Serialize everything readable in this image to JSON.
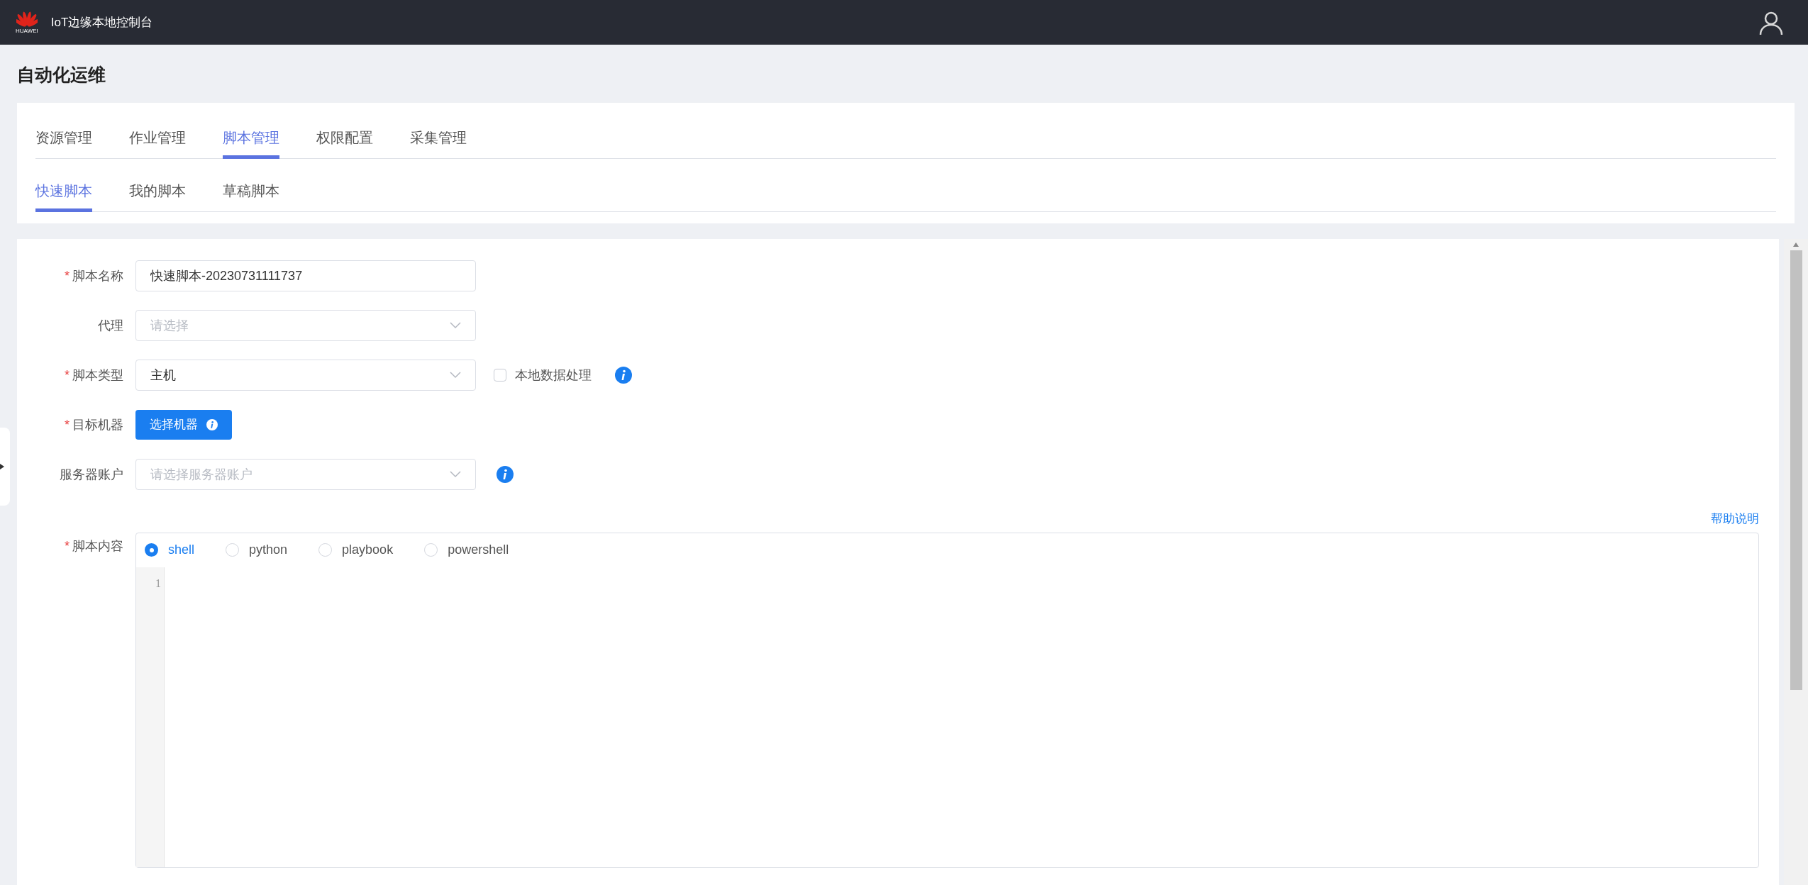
{
  "header": {
    "brand": "HUAWEI",
    "title": "IoT边缘本地控制台"
  },
  "page_title": "自动化运维",
  "tabs": [
    {
      "label": "资源管理",
      "selected": false
    },
    {
      "label": "作业管理",
      "selected": false
    },
    {
      "label": "脚本管理",
      "selected": true
    },
    {
      "label": "权限配置",
      "selected": false
    },
    {
      "label": "采集管理",
      "selected": false
    }
  ],
  "subtabs": [
    {
      "label": "快速脚本",
      "selected": true
    },
    {
      "label": "我的脚本",
      "selected": false
    },
    {
      "label": "草稿脚本",
      "selected": false
    }
  ],
  "form": {
    "fields": [
      {
        "kind": "input",
        "label": "脚本名称",
        "required_mark": "*",
        "value": "快速脚本-20230731111737"
      },
      {
        "kind": "select",
        "label": "代理",
        "placeholder": "请选择"
      },
      {
        "kind": "select",
        "label": "脚本类型",
        "required_mark": "*",
        "value": "主机",
        "checkbox": {
          "label": "本地数据处理",
          "checked": false
        },
        "addons": [
          {
            "kind": "info"
          }
        ]
      },
      {
        "kind": "button",
        "label": "目标机器",
        "required_mark": "*",
        "button": "选择机器"
      },
      {
        "kind": "select",
        "label": "服务器账户",
        "placeholder": "请选择服务器账户",
        "addons": [
          {
            "kind": "info"
          }
        ]
      }
    ],
    "help_link": "帮助说明",
    "script": {
      "label": "脚本内容",
      "required_mark": "*",
      "languages": [
        {
          "label": "shell",
          "selected": true
        },
        {
          "label": "python",
          "selected": false
        },
        {
          "label": "playbook",
          "selected": false
        },
        {
          "label": "powershell",
          "selected": false
        }
      ],
      "line_numbers": [
        "1"
      ]
    }
  }
}
